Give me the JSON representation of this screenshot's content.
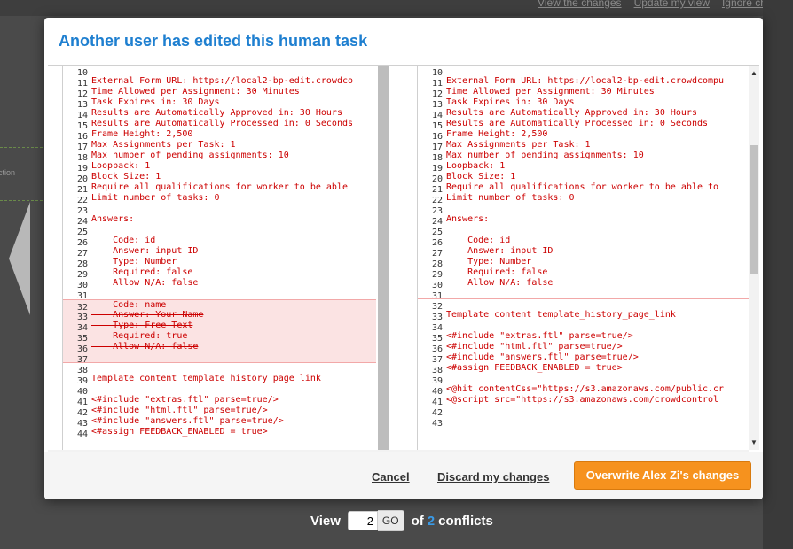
{
  "background": {
    "links": [
      "View the changes",
      "Update my view",
      "Ignore chang"
    ],
    "side_text": "ction"
  },
  "modal": {
    "title": "Another user has edited this human task"
  },
  "left_pane": {
    "lines": [
      {
        "n": "10",
        "t": "",
        "type": "normal"
      },
      {
        "n": "11",
        "t": "External Form URL: https://local2-bp-edit.crowdco",
        "type": "normal"
      },
      {
        "n": "12",
        "t": "Time Allowed per Assignment: 30 Minutes",
        "type": "normal"
      },
      {
        "n": "13",
        "t": "Task Expires in: 30 Days",
        "type": "normal"
      },
      {
        "n": "14",
        "t": "Results are Automatically Approved in: 30 Hours",
        "type": "normal"
      },
      {
        "n": "15",
        "t": "Results are Automatically Processed in: 0 Seconds",
        "type": "normal"
      },
      {
        "n": "16",
        "t": "Frame Height: 2,500",
        "type": "normal"
      },
      {
        "n": "17",
        "t": "Max Assignments per Task: 1",
        "type": "normal"
      },
      {
        "n": "18",
        "t": "Max number of pending assignments: 10",
        "type": "normal"
      },
      {
        "n": "19",
        "t": "Loopback: 1",
        "type": "normal"
      },
      {
        "n": "20",
        "t": "Block Size: 1",
        "type": "normal"
      },
      {
        "n": "21",
        "t": "Require all qualifications for worker to be able",
        "type": "normal"
      },
      {
        "n": "22",
        "t": "Limit number of tasks: 0",
        "type": "normal"
      },
      {
        "n": "23",
        "t": "",
        "type": "normal"
      },
      {
        "n": "24",
        "t": "Answers:",
        "type": "normal"
      },
      {
        "n": "25",
        "t": "",
        "type": "normal"
      },
      {
        "n": "26",
        "t": "    Code: id",
        "type": "normal"
      },
      {
        "n": "27",
        "t": "    Answer: input ID",
        "type": "normal"
      },
      {
        "n": "28",
        "t": "    Type: Number",
        "type": "normal"
      },
      {
        "n": "29",
        "t": "    Required: false",
        "type": "normal"
      },
      {
        "n": "30",
        "t": "    Allow N/A: false",
        "type": "normal"
      },
      {
        "n": "31",
        "t": "",
        "type": "normal"
      },
      {
        "n": "32",
        "t": "    Code: name",
        "type": "del"
      },
      {
        "n": "33",
        "t": "    Answer: Your Name",
        "type": "del"
      },
      {
        "n": "34",
        "t": "    Type: Free Text",
        "type": "del"
      },
      {
        "n": "35",
        "t": "    Required: true",
        "type": "del"
      },
      {
        "n": "36",
        "t": "    Allow N/A: false",
        "type": "del"
      },
      {
        "n": "37",
        "t": "",
        "type": "del"
      },
      {
        "n": "38",
        "t": "",
        "type": "normal"
      },
      {
        "n": "39",
        "t": "Template content template_history_page_link",
        "type": "normal"
      },
      {
        "n": "40",
        "t": "",
        "type": "normal"
      },
      {
        "n": "41",
        "t": "<#include \"extras.ftl\" parse=true/>",
        "type": "normal"
      },
      {
        "n": "42",
        "t": "<#include \"html.ftl\" parse=true/>",
        "type": "normal"
      },
      {
        "n": "43",
        "t": "<#include \"answers.ftl\" parse=true/>",
        "type": "normal"
      },
      {
        "n": "44",
        "t": "<#assign FEEDBACK_ENABLED = true>",
        "type": "normal"
      }
    ]
  },
  "right_pane": {
    "lines": [
      {
        "n": "10",
        "t": "",
        "type": "normal"
      },
      {
        "n": "11",
        "t": "External Form URL: https://local2-bp-edit.crowdcompu",
        "type": "normal"
      },
      {
        "n": "12",
        "t": "Time Allowed per Assignment: 30 Minutes",
        "type": "normal"
      },
      {
        "n": "13",
        "t": "Task Expires in: 30 Days",
        "type": "normal"
      },
      {
        "n": "14",
        "t": "Results are Automatically Approved in: 30 Hours",
        "type": "normal"
      },
      {
        "n": "15",
        "t": "Results are Automatically Processed in: 0 Seconds",
        "type": "normal"
      },
      {
        "n": "16",
        "t": "Frame Height: 2,500",
        "type": "normal"
      },
      {
        "n": "17",
        "t": "Max Assignments per Task: 1",
        "type": "normal"
      },
      {
        "n": "18",
        "t": "Max number of pending assignments: 10",
        "type": "normal"
      },
      {
        "n": "19",
        "t": "Loopback: 1",
        "type": "normal"
      },
      {
        "n": "20",
        "t": "Block Size: 1",
        "type": "normal"
      },
      {
        "n": "21",
        "t": "Require all qualifications for worker to be able to",
        "type": "normal"
      },
      {
        "n": "22",
        "t": "Limit number of tasks: 0",
        "type": "normal"
      },
      {
        "n": "23",
        "t": "",
        "type": "normal"
      },
      {
        "n": "24",
        "t": "Answers:",
        "type": "normal"
      },
      {
        "n": "25",
        "t": "",
        "type": "normal"
      },
      {
        "n": "26",
        "t": "    Code: id",
        "type": "normal"
      },
      {
        "n": "27",
        "t": "    Answer: input ID",
        "type": "normal"
      },
      {
        "n": "28",
        "t": "    Type: Number",
        "type": "normal"
      },
      {
        "n": "29",
        "t": "    Required: false",
        "type": "normal"
      },
      {
        "n": "30",
        "t": "    Allow N/A: false",
        "type": "normal"
      },
      {
        "n": "31",
        "t": "",
        "type": "mark"
      },
      {
        "n": "32",
        "t": "",
        "type": "normal"
      },
      {
        "n": "33",
        "t": "Template content template_history_page_link",
        "type": "normal"
      },
      {
        "n": "34",
        "t": "",
        "type": "normal"
      },
      {
        "n": "35",
        "t": "<#include \"extras.ftl\" parse=true/>",
        "type": "normal"
      },
      {
        "n": "36",
        "t": "<#include \"html.ftl\" parse=true/>",
        "type": "normal"
      },
      {
        "n": "37",
        "t": "<#include \"answers.ftl\" parse=true/>",
        "type": "normal"
      },
      {
        "n": "38",
        "t": "<#assign FEEDBACK_ENABLED = true>",
        "type": "normal"
      },
      {
        "n": "39",
        "t": "",
        "type": "normal"
      },
      {
        "n": "40",
        "t": "<@hit contentCss=\"https://s3.amazonaws.com/public.cr",
        "type": "normal"
      },
      {
        "n": "41",
        "t": "<@script src=\"https://s3.amazonaws.com/crowdcontrol",
        "type": "normal"
      },
      {
        "n": "42",
        "t": "",
        "type": "normal"
      },
      {
        "n": "43",
        "t": "",
        "type": "normal"
      }
    ]
  },
  "footer": {
    "cancel_label": "Cancel",
    "discard_label": "Discard my changes",
    "overwrite_label": "Overwrite Alex Zi's changes"
  },
  "pager": {
    "view_label": "View",
    "current": "2",
    "go_label": "GO",
    "of_label": "of",
    "total": "2",
    "conflicts_label": "conflicts"
  },
  "colors": {
    "title": "#1e7fd0",
    "primary_button": "#f6921e",
    "code_text": "#cc0000",
    "deleted_bg": "#fbe3e3",
    "pager_count": "#3a9be8"
  }
}
